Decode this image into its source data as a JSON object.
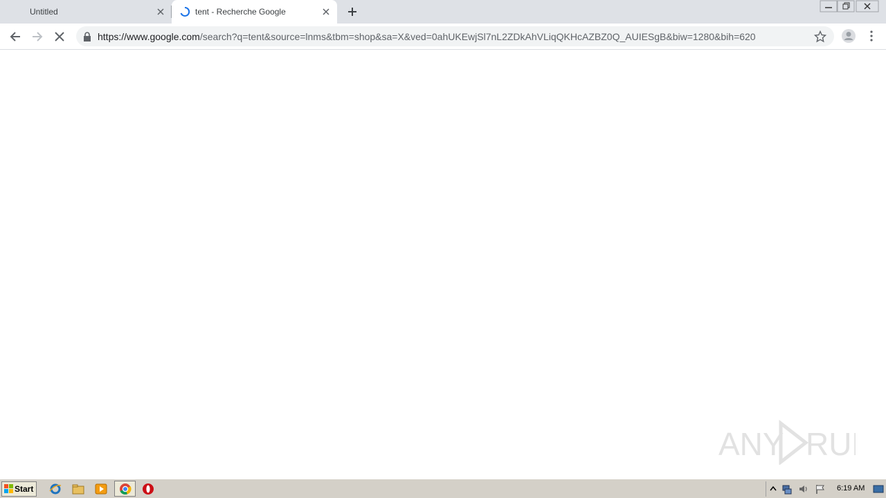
{
  "browser": {
    "tabs": [
      {
        "title": "Untitled",
        "active": false,
        "loading": false
      },
      {
        "title": "tent - Recherche Google",
        "active": true,
        "loading": true
      }
    ],
    "address_bar": {
      "host": "https://www.google.com",
      "path": "/search?q=tent&source=lnms&tbm=shop&sa=X&ved=0ahUKEwjSl7nL2ZDkAhVLiqQKHcAZBZ0Q_AUIESgB&biw=1280&bih=620",
      "secure": true
    },
    "icons": {
      "back": "back-arrow-icon",
      "forward": "forward-arrow-icon",
      "stop": "stop-x-icon",
      "bookmark": "star-icon",
      "profile": "avatar-icon",
      "menu": "kebab-menu-icon"
    }
  },
  "watermark": {
    "text": "ANY RUN"
  },
  "taskbar": {
    "start_label": "Start",
    "quick_launch": [
      "internet-explorer-icon",
      "explorer-folder-icon",
      "media-player-icon",
      "chrome-icon",
      "opera-icon"
    ],
    "tray_icons": [
      "show-hidden-icon",
      "network-icon",
      "volume-icon",
      "action-center-flag-icon"
    ],
    "clock": "6:19 AM"
  },
  "colors": {
    "titlebar": "#dee1e6",
    "omnibox": "#f1f3f4",
    "taskbar": "#d4d0c8",
    "spinner": "#1a73e8"
  }
}
